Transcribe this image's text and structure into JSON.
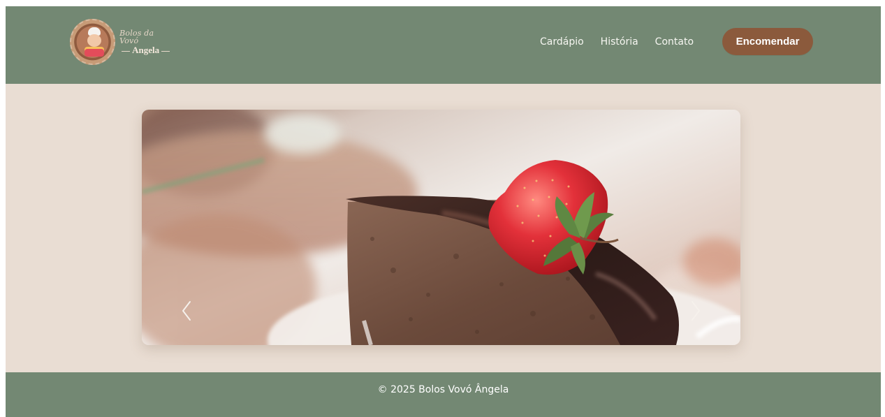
{
  "header": {
    "logo": {
      "line1": "Bolos da Vovó",
      "line2": "Angela"
    },
    "nav": [
      {
        "label": "Cardápio"
      },
      {
        "label": "História"
      },
      {
        "label": "Contato"
      }
    ],
    "order_button": "Encomendar"
  },
  "carousel": {
    "image": "chocolate-cake-with-strawberry",
    "prev_icon": "chevron-left-icon",
    "next_icon": "chevron-right-icon"
  },
  "footer": {
    "text": "© 2025 Bolos Vovó Ângela"
  },
  "colors": {
    "header_bg": "#738873",
    "page_bg": "#e9ddd3",
    "button_bg": "#8b5a3c",
    "footer_bg": "#738873"
  }
}
